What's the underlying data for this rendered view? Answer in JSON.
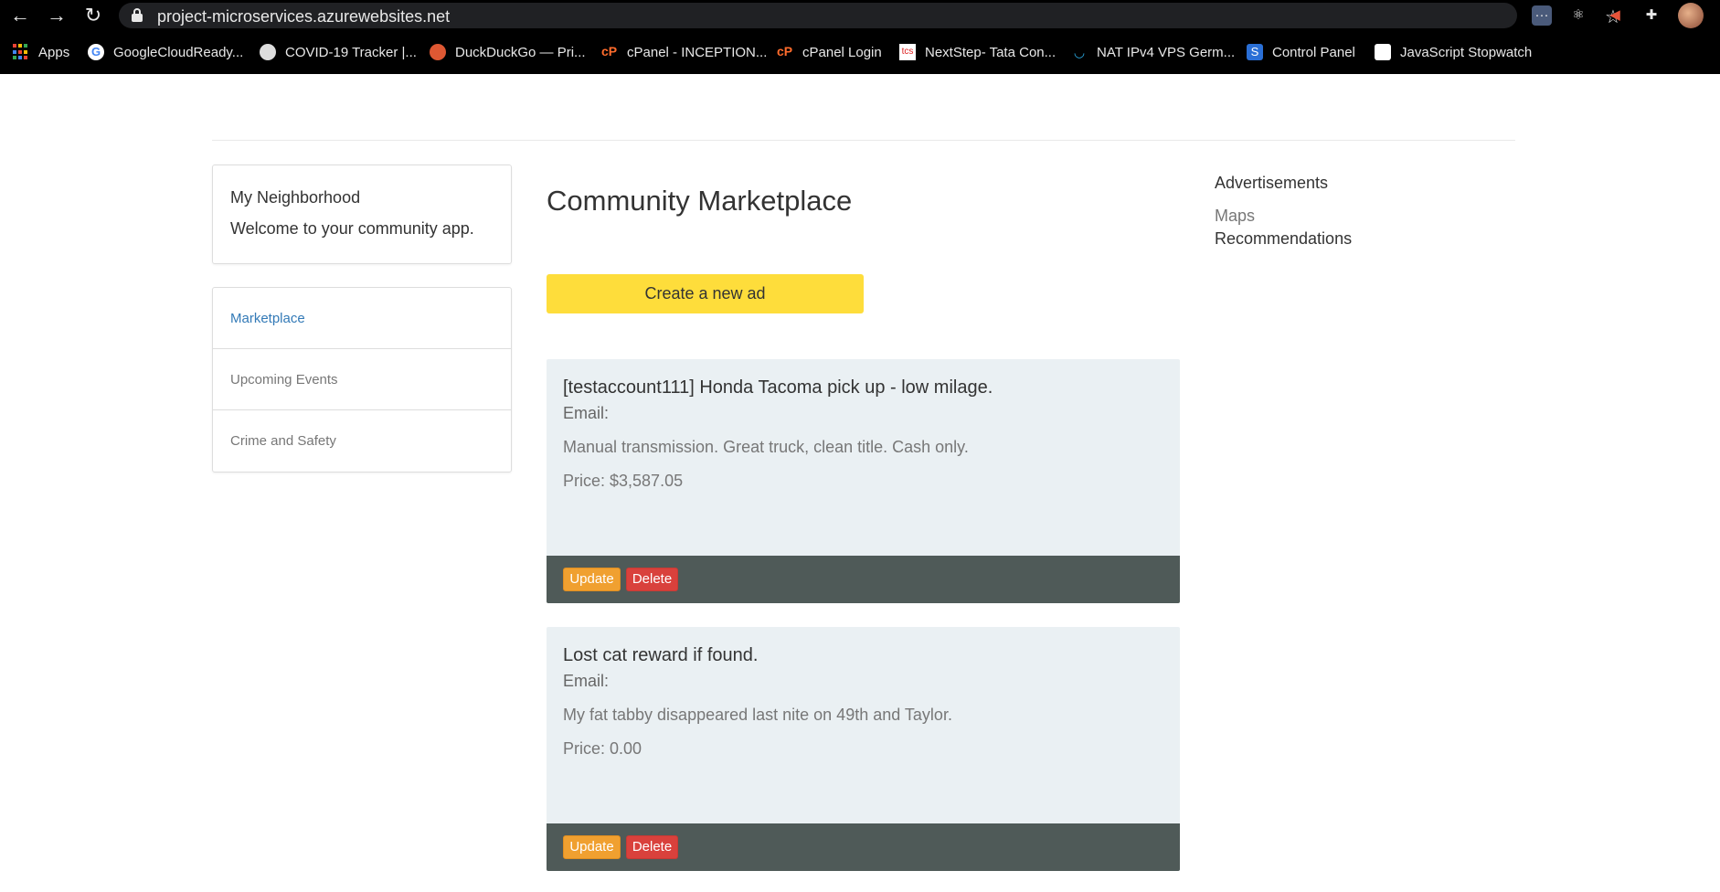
{
  "browser": {
    "url": "project-microservices.azurewebsites.net",
    "bookmarks": [
      {
        "label": "Apps",
        "icon": "apps-grid-icon"
      },
      {
        "label": "GoogleCloudReady...",
        "icon": "google-icon"
      },
      {
        "label": "COVID-19 Tracker |...",
        "icon": "covid-tracker-icon"
      },
      {
        "label": "DuckDuckGo — Pri...",
        "icon": "duckduckgo-icon"
      },
      {
        "label": "cPanel - INCEPTION...",
        "icon": "cpanel-icon"
      },
      {
        "label": "cPanel Login",
        "icon": "cpanel-icon"
      },
      {
        "label": "NextStep- Tata Con...",
        "icon": "tcs-icon"
      },
      {
        "label": "NAT IPv4 VPS Germ...",
        "icon": "vps-icon"
      },
      {
        "label": "Control Panel",
        "icon": "control-panel-icon"
      },
      {
        "label": "JavaScript Stopwatch",
        "icon": "stopwatch-icon"
      }
    ]
  },
  "intro": {
    "title": "My Neighborhood",
    "subtitle": "Welcome to your community app."
  },
  "sidebar": {
    "items": [
      {
        "label": "Marketplace",
        "active": true
      },
      {
        "label": "Upcoming Events",
        "active": false
      },
      {
        "label": "Crime and Safety",
        "active": false
      }
    ]
  },
  "main": {
    "title": "Community Marketplace",
    "create_label": "Create a new ad",
    "ads": [
      {
        "title": "[testaccount111] Honda Tacoma pick up - low milage.",
        "email": "Email:",
        "description": "Manual transmission. Great truck, clean title. Cash only.",
        "price": "Price: $3,587.05",
        "update_label": "Update",
        "delete_label": "Delete"
      },
      {
        "title": "Lost cat reward if found.",
        "email": "Email:",
        "description": "My fat tabby disappeared last nite on 49th and Taylor.",
        "price": "Price: 0.00",
        "update_label": "Update",
        "delete_label": "Delete"
      }
    ]
  },
  "right": {
    "heading": "Advertisements",
    "links": [
      "Maps",
      "Recommendations"
    ]
  },
  "colors": {
    "accent_yellow": "#fedd3b",
    "update_orange": "#f0a030",
    "delete_red": "#d9413c",
    "card_bg": "#eaf0f3",
    "footer_bg": "#4f5a58",
    "link_blue": "#337ab7"
  }
}
